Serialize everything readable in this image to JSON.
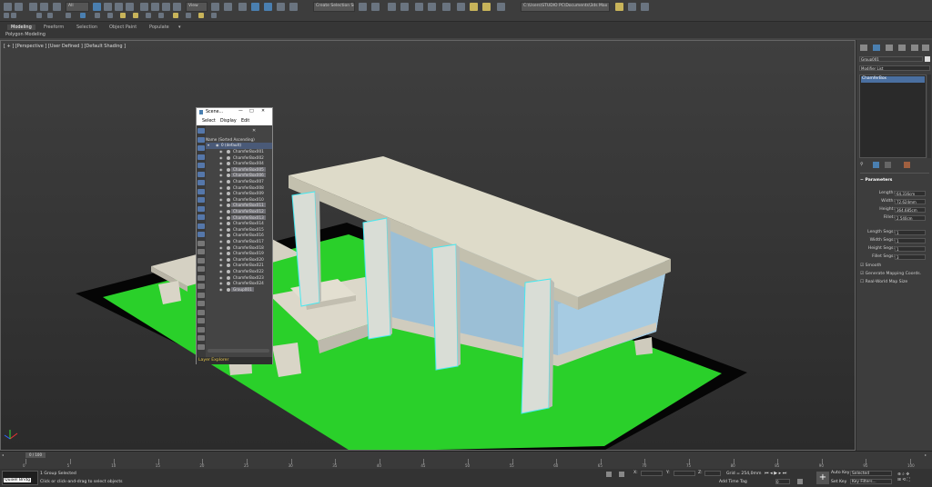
{
  "toolbar": {
    "view_dropdown": "View",
    "selection_set": "Create Selection Se",
    "path": "C:\\Users\\STUDIO PC\\Documents\\3ds Max 2020"
  },
  "ribbon": {
    "tabs": [
      "Modeling",
      "Freeform",
      "Selection",
      "Object Paint",
      "Populate"
    ],
    "sub_label": "Polygon Modeling"
  },
  "viewport": {
    "label": "[ + ] [Perspective ] [User Defined ] [Default Shading ]"
  },
  "scene_explorer": {
    "title": "Scene...",
    "menu": [
      "Select",
      "Display",
      "Edit"
    ],
    "header": "Name (Sorted Ascending)",
    "layer": "0 (default)",
    "items": [
      "ChamferBox001",
      "ChamferBox002",
      "ChamferBox004",
      "ChamferBox005",
      "ChamferBox006",
      "ChamferBox007",
      "ChamferBox008",
      "ChamferBox009",
      "ChamferBox010",
      "ChamferBox011",
      "ChamferBox012",
      "ChamferBox013",
      "ChamferBox014",
      "ChamferBox015",
      "ChamferBox016",
      "ChamferBox017",
      "ChamferBox018",
      "ChamferBox019",
      "ChamferBox020",
      "ChamferBox021",
      "ChamferBox022",
      "ChamferBox023",
      "ChamferBox024",
      "Group001"
    ],
    "selected_items": [
      3,
      4,
      9,
      10,
      11,
      23
    ],
    "footer": "Layer Explorer"
  },
  "command_panel": {
    "object_name": "Group001",
    "modifier_list": "Modifier List",
    "stack_item": "ChamferBox",
    "rollout": "Parameters",
    "params": [
      {
        "label": "Length:",
        "value": "64,316cm"
      },
      {
        "label": "Width:",
        "value": "72,624mm"
      },
      {
        "label": "Height:",
        "value": "364,685cm"
      },
      {
        "label": "Fillet:",
        "value": "2,540cm"
      }
    ],
    "segs": [
      {
        "label": "Length Segs:",
        "value": "1"
      },
      {
        "label": "Width Segs:",
        "value": "1"
      },
      {
        "label": "Height Segs:",
        "value": "1"
      },
      {
        "label": "Fillet Segs:",
        "value": "3"
      }
    ],
    "checks": [
      {
        "label": "Smooth",
        "checked": true
      },
      {
        "label": "Generate Mapping Coords.",
        "checked": true
      },
      {
        "label": "Real-World Map Size",
        "checked": false
      }
    ]
  },
  "timeline": {
    "frame": "0 / 100",
    "ticks": [
      "0",
      "5",
      "10",
      "15",
      "20",
      "25",
      "30",
      "35",
      "40",
      "45",
      "50",
      "55",
      "60",
      "65",
      "70",
      "75",
      "80",
      "85",
      "90",
      "95",
      "100"
    ]
  },
  "status": {
    "script_label": "Quixel Bridg",
    "line1": "1 Group Selected",
    "line2": "Click or click-and-drag to select objects",
    "grid": "Grid = 254,0mm",
    "add_time_tag": "Add Time Tag",
    "auto_key": "Auto Key",
    "set_key": "Set Key",
    "selected": "Selected",
    "key_filters": "Key Filters..."
  }
}
